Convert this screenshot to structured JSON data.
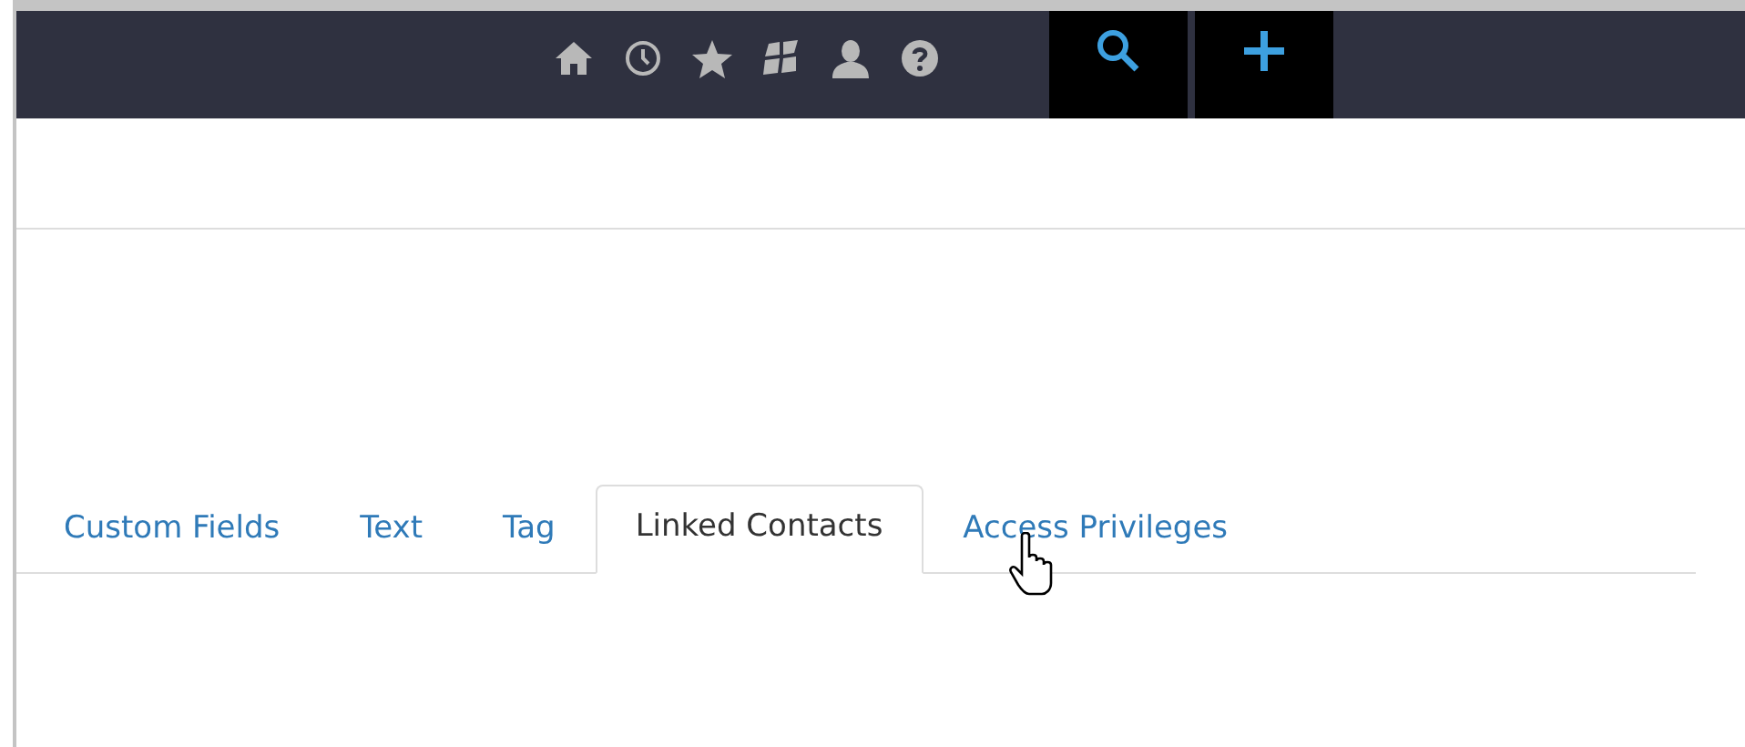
{
  "tabs": [
    {
      "label": "Custom Fields",
      "selected": false
    },
    {
      "label": "Text",
      "selected": false
    },
    {
      "label": "Tag",
      "selected": false
    },
    {
      "label": "Linked Contacts",
      "selected": true
    },
    {
      "label": "Access Privileges",
      "selected": false
    }
  ]
}
